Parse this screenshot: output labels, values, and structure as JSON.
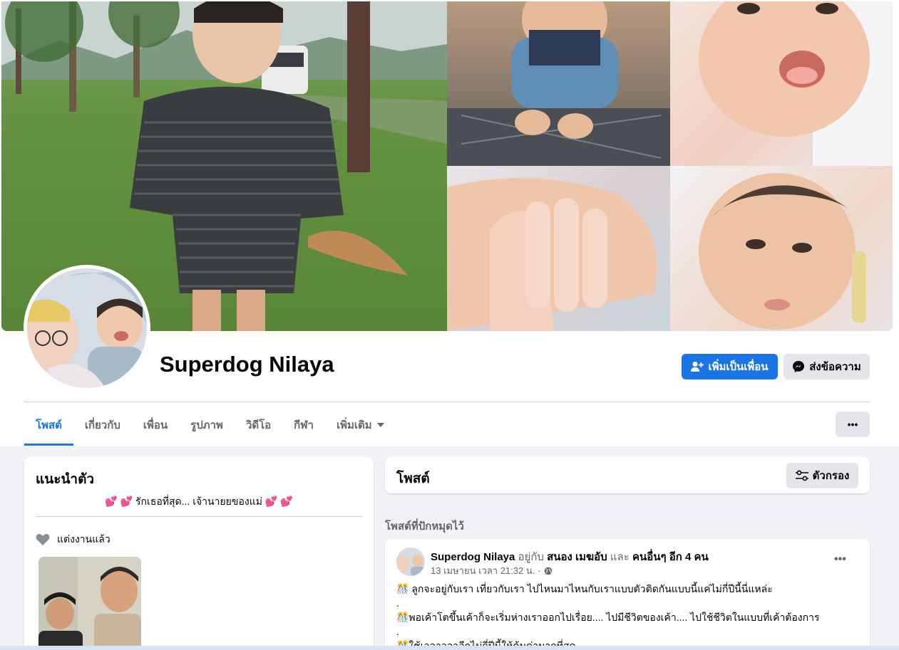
{
  "profile": {
    "name": "Superdog Nilaya",
    "add_friend_label": "เพิ่มเป็นเพื่อน",
    "message_label": "ส่งข้อความ"
  },
  "tabs": [
    {
      "label": "โพสต์",
      "active": true
    },
    {
      "label": "เกี่ยวกับ"
    },
    {
      "label": "เพื่อน"
    },
    {
      "label": "รูปภาพ"
    },
    {
      "label": "วิดีโอ"
    },
    {
      "label": "กีฬา"
    },
    {
      "label": "เพิ่มเติม"
    }
  ],
  "more_label": "•••",
  "intro": {
    "title": "แนะนำตัว",
    "bio": "💕 💕 รักเธอที่สุด... เจ้านายยของแม่ 💕 💕",
    "relationship": "แต่งงานแล้ว"
  },
  "posts": {
    "title": "โพสต์",
    "filter_label": "ตัวกรอง",
    "pinned_label": "โพสต์ที่ปักหมุดไว้"
  },
  "post": {
    "author": "Superdog Nilaya",
    "with_word": "อยู่กับ",
    "tagged": "สนอง เมฆอับ",
    "and_word": "และ",
    "others": "คนอื่นๆ อีก 4 คน",
    "timestamp": "13 เมษายน เวลา 21:32 น.",
    "separator": "·",
    "dots": "•••",
    "lines": [
      "🎊 ลูกจะอยู่กับเรา เที่ยวกับเรา ไปไหนมาไหนกับเราแบบตัวติดกันแบบนี้แค่ไม่กี่ปีนี้นี่แหล่ะ",
      ".",
      "🎊พอเค้าโตขึ้นเค้าก็จะเริ่มห่างเราออกไปเรื่อย.... ไปมีชีวิตของเค้า.... ไปใช้ชีวิตในแบบที่เค้าต้องการ",
      ".",
      "🎊ใช้เวลาวลาอีกไม่กี่ปีนี้ให้คุ้มค่ามากที่สุด"
    ]
  },
  "colors": {
    "accent": "#1b74e4",
    "secondary_button": "#e4e6eb",
    "page_bg": "#f0f2f5"
  },
  "icons": {
    "add_friend": "person-plus-icon",
    "message": "messenger-icon",
    "dropdown": "caret-down-icon",
    "heart": "heart-icon",
    "filter": "sliders-icon",
    "globe": "globe-icon"
  }
}
